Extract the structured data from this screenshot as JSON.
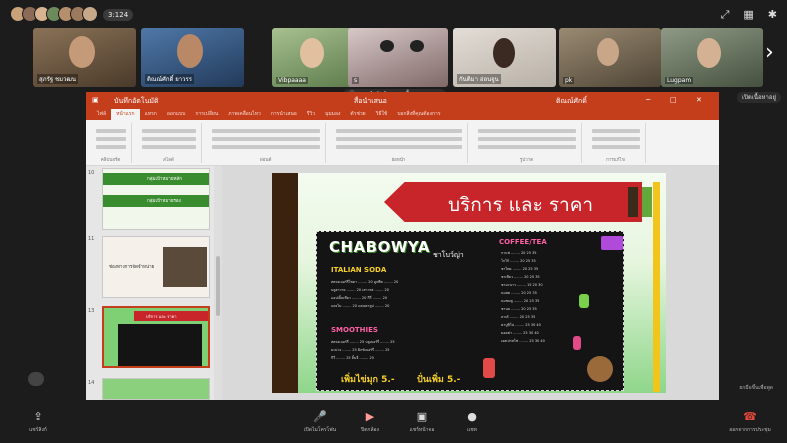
{
  "topbar": {
    "participant_count": "3:124",
    "icons": [
      "fullscreen-icon",
      "grid-icon",
      "gear-icon"
    ],
    "avatar_colors": [
      "#c9a27a",
      "#8b6b55",
      "#d7b48f",
      "#6d8a5d",
      "#b58e6b",
      "#9d7a5f",
      "#c7a98a"
    ]
  },
  "strip": {
    "tiles": [
      {
        "name": "สุภรัฐ ชมวฒน",
        "color": "#6f5b44"
      },
      {
        "name": "ติณณ์ศักดิ์ ยาวรร",
        "color": "#3a5f8c"
      },
      {
        "name": "Vibpaaaa",
        "color": "#8aa57a"
      },
      {
        "name": "s",
        "color": "#3a3a3a"
      },
      {
        "name": "กันติมา อ่อนจูน",
        "color": "#cfcac2"
      },
      {
        "name": "pk",
        "color": "#7b6c58"
      },
      {
        "name": "Lugpam",
        "color": "#6f7a68"
      }
    ]
  },
  "share_pill": "คุณกำลังนำเสนอเนื้อหาของคุณ",
  "side_button": "เปิดเนื้อหาอยู่",
  "ppt": {
    "title_left": "บันทึกอัตโนมัติ",
    "title_center": "สื่อนำเสนอ",
    "title_user": "ติณณ์ศักดิ์",
    "tabs": [
      "ไฟล์",
      "หน้าแรก",
      "แทรก",
      "ออกแบบ",
      "การเปลี่ยน",
      "ภาพเคลื่อนไหว",
      "การนำเสนอ",
      "รีวิว",
      "มุมมอง",
      "ตัวช่วย",
      "วิธีใช้",
      "บอกสิ่งที่คุณต้องการ"
    ],
    "active_tab": 1,
    "ribbon_groups": [
      "คลิปบอร์ด",
      "สไลด์",
      "ฟอนต์",
      "ย่อหน้า",
      "รูปวาด",
      "การแก้ไข"
    ]
  },
  "thumbnails": [
    {
      "num": "10",
      "title": "กลุ่มเป้าหมายหลัก"
    },
    {
      "num": "11",
      "title": "กลุ่มเป้าหมายรอง"
    },
    {
      "num": "12",
      "title": "ช่องทางการจัดจำหน่าย"
    },
    {
      "num": "13",
      "title": "บริการ และ ราคา"
    },
    {
      "num": "14",
      "title": ""
    }
  ],
  "slide": {
    "banner_title": "บริการ และ ราคา",
    "brand": "CHABOWYA",
    "brand_thai": "ชาโบว์ญ่า",
    "sections": {
      "italian": "ITALIAN SODA",
      "smoothies": "SMOOTHIES",
      "coffee": "COFFEE/TEA"
    },
    "italian_rows": [
      "สตรอเบอร์รี่โซดา ........ 20   ลูกพีช ........ 20",
      "บลูฮาวาย ........ 20   เสาวรส ........ 20",
      "แอปเปิ้ลเขียว ........ 20   กีวี่ ........ 20",
      "แตงโม ........ 20   แคนตาลูป ........ 20"
    ],
    "smoothie_rows": [
      "สตรอเบอร์รี่ ........ 25   บลูเบอร์รี่ ........ 25",
      "มะม่วง ........ 25   มิกซ์เบอร์รี่ ........ 25",
      "กีวี่ ........ 25   ลิ้นจี่ ........ 25"
    ],
    "coffee_rows": [
      "กาแฟ ........ 20  25  35",
      "โกโก้ ........ 20  25  35",
      "ชาไทย ........ 20  25  35",
      "ชาเขียว ........ 20  25  35",
      "ชามะนาว ........ 15  20  30",
      "นมสด ........ 20  25  35",
      "นมชมพู ........ 20  25  35",
      "ชานม ........ 20  25  35",
      "ลาเต้ ........ 20  25  35",
      "คาปูชิโน่ ........ 25  30  40",
      "มอคค่า ........ 25  30  40",
      "เอสเปรสโซ่ ........ 25  30  40"
    ],
    "promo_left": "เพิ่มไข่มุก 5.-",
    "promo_right": "ปั่นเพิ่ม 5.-"
  },
  "bottom": {
    "left_label": "แชร์ลิงก์",
    "buttons": [
      {
        "icon": "mic-icon",
        "label": "เปิดไมโครโฟน"
      },
      {
        "icon": "camera-off-icon",
        "label": "ปิดกล้อง"
      },
      {
        "icon": "share-screen-icon",
        "label": "แชร์หน้าจอ"
      },
      {
        "icon": "chat-icon",
        "label": "แชท"
      }
    ],
    "leave_label": "ออกจากการประชุม",
    "hand_hint": "ยกมือขึ้นเพื่อพูด"
  }
}
